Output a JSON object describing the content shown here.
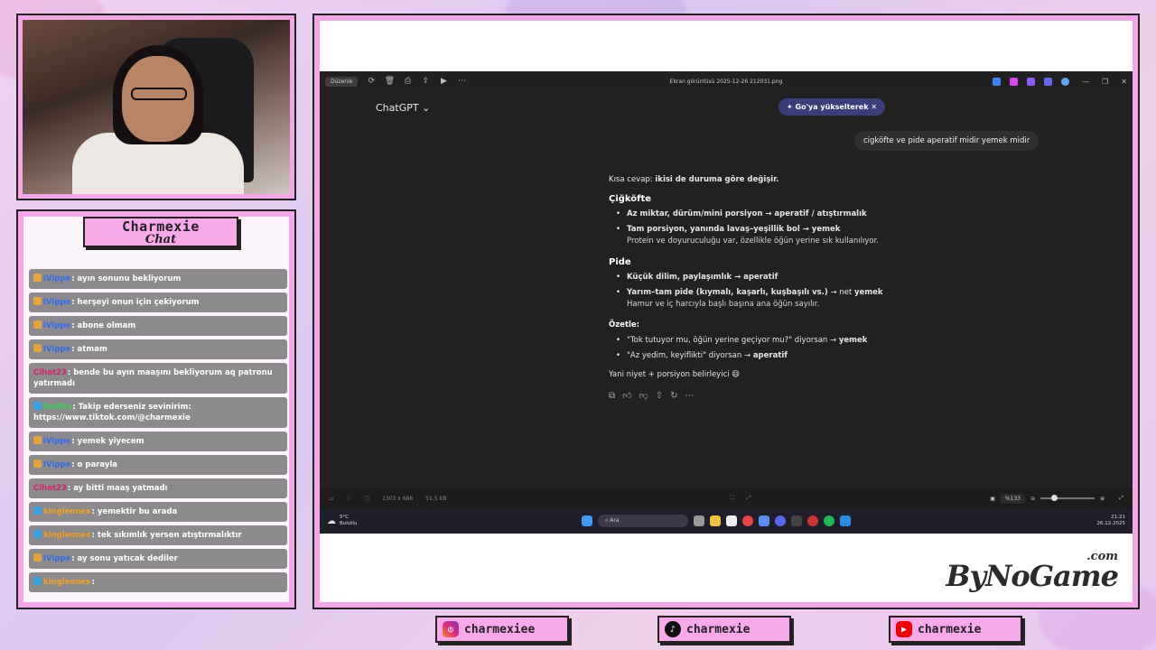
{
  "webcam": {
    "label": ""
  },
  "chat": {
    "title": "Charmexie",
    "subtitle": "Chat",
    "messages": [
      {
        "user": "iVippe",
        "text": ": ayın sonunu bekliyorum",
        "user_color": "#2f6cf0",
        "badge_color": "#e4a63a"
      },
      {
        "user": "iVippe",
        "text": ": herşeyi onun için çekiyorum",
        "user_color": "#2f6cf0",
        "badge_color": "#e4a63a"
      },
      {
        "user": "iVippe",
        "text": ": abone olmam",
        "user_color": "#2f6cf0",
        "badge_color": "#e4a63a"
      },
      {
        "user": "iVippe",
        "text": ": atmam",
        "user_color": "#2f6cf0",
        "badge_color": "#e4a63a"
      },
      {
        "user": "Cihat23",
        "text": ": bende bu ayın maaşını bekliyorum aq patronu yatırmadı",
        "user_color": "#d6246a",
        "badge_color": ""
      },
      {
        "user": "BotRix",
        "text": ": Takip ederseniz sevinirim: https://www.tiktok.com/@charmexie",
        "user_color": "#36d15a",
        "badge_color": "#3aa2e0"
      },
      {
        "user": "iVippe",
        "text": ": yemek yiyecem",
        "user_color": "#2f6cf0",
        "badge_color": "#e4a63a"
      },
      {
        "user": "iVippe",
        "text": ": o parayla",
        "user_color": "#2f6cf0",
        "badge_color": "#e4a63a"
      },
      {
        "user": "Cihat23",
        "text": ": ay bitti maaş yatmadı",
        "user_color": "#d6246a",
        "badge_color": ""
      },
      {
        "user": "kingleonex",
        "text": ": yemektir bu arada",
        "user_color": "#f0a020",
        "badge_color": "#3aa2e0"
      },
      {
        "user": "kingleonex",
        "text": ": tek sıkımlık yersen atıştırmalıktır",
        "user_color": "#f0a020",
        "badge_color": "#3aa2e0"
      },
      {
        "user": "iVippe",
        "text": ": ay sonu yatıcak dediler",
        "user_color": "#2f6cf0",
        "badge_color": "#e4a63a"
      },
      {
        "user": "kingleonex",
        "text": ":",
        "user_color": "#f0a020",
        "badge_color": "#3aa2e0"
      }
    ]
  },
  "photos": {
    "edit_label": "Düzenle",
    "filename": "Ekran görüntüsü 2025-12-26 212031.png",
    "dimensions": "1303 x 686",
    "filesize": "51,5 KB",
    "zoom": "%133"
  },
  "chatgpt": {
    "model": "ChatGPT",
    "upgrade": "Go'ya yükselterek",
    "user_message": "cigköfte ve pide aperatif midir yemek midir",
    "intro_plain": "Kısa cevap: ",
    "intro_bold": "ikisi de duruma göre değişir.",
    "sec1_title": "Çiğköfte",
    "sec1_item1": "Az miktar, dürüm/mini porsiyon → aperatif / atıştırmalık",
    "sec1_item2": "Tam porsiyon, yanında lavaş–yeşillik bol → yemek",
    "sec1_item2_sub": "Protein ve doyuruculuğu var, özellikle öğün yerine sık kullanılıyor.",
    "sec2_title": "Pide",
    "sec2_item1": "Küçük dilim, paylaşımlık → aperatif",
    "sec2_item2_bold": "Yarım–tam pide (kıymalı, kaşarlı, kuşbaşılı vs.)",
    "sec2_item2_plain": " → net ",
    "sec2_item2_end": "yemek",
    "sec2_item2_sub": "Hamur ve iç harcıyla başlı başına ana öğün sayılır.",
    "sec3_title": "Özetle:",
    "sec3_item1_plain": "\"Tok tutuyor mu, öğün yerine geçiyor mu?\" diyorsan → ",
    "sec3_item1_bold": "yemek",
    "sec3_item2_plain": "\"Az yedim, keyiflikti\" diyorsan → ",
    "sec3_item2_bold": "aperatif",
    "outro": "Yani niyet + porsiyon belirleyici 😄"
  },
  "taskbar": {
    "weather_temp": "5°C",
    "weather_desc": "Bulutlu",
    "search": "Ara",
    "time": "21:21",
    "date": "26.12.2025"
  },
  "watermark": {
    "brand": "ByNoGame",
    "suffix": ".com"
  },
  "socials": {
    "instagram": "charmexiee",
    "tiktok": "charmexie",
    "youtube": "charmexie"
  },
  "colors": {
    "frame_pink": "#f3a6e6",
    "chat_bubble": "#8d8a8d",
    "chatgpt_bg": "#212121"
  }
}
